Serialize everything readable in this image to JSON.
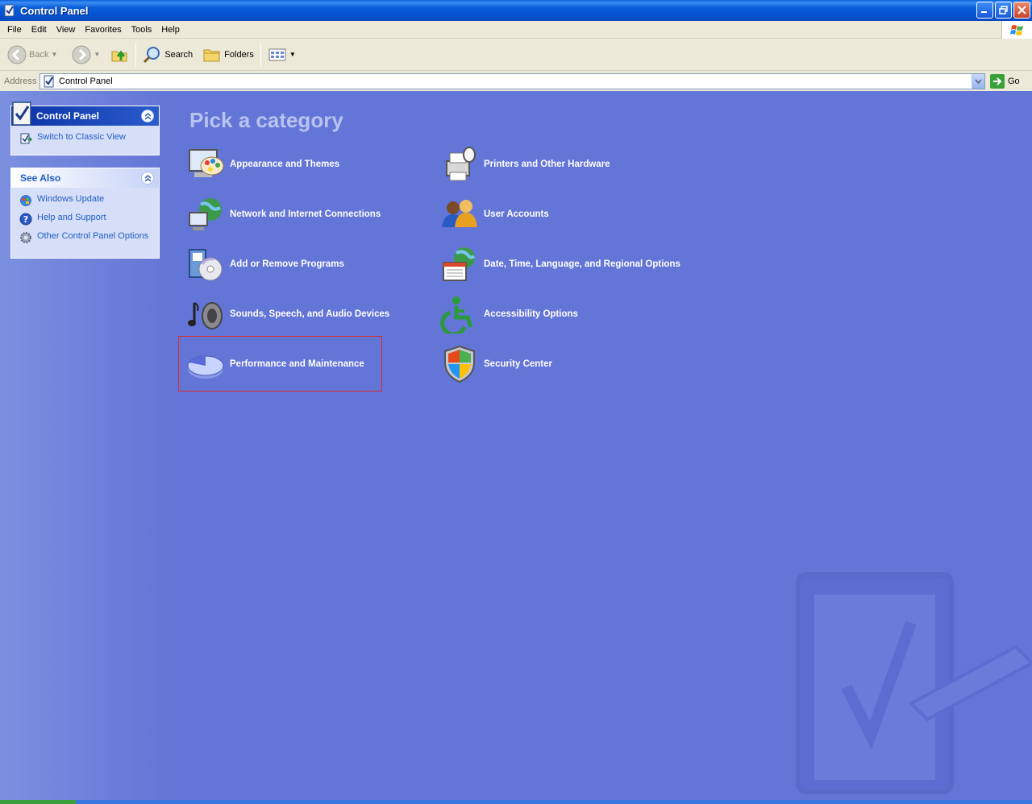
{
  "window": {
    "title": "Control Panel"
  },
  "menu": [
    "File",
    "Edit",
    "View",
    "Favorites",
    "Tools",
    "Help"
  ],
  "toolbar": {
    "back": "Back",
    "search": "Search",
    "folders": "Folders"
  },
  "address": {
    "label": "Address",
    "value": "Control Panel",
    "go": "Go"
  },
  "sidebar": {
    "control_panel": {
      "title": "Control Panel",
      "tasks": [
        {
          "label": "Switch to Classic View",
          "icon": "classic-view-icon"
        }
      ]
    },
    "see_also": {
      "title": "See Also",
      "tasks": [
        {
          "label": "Windows Update",
          "icon": "windows-update-icon"
        },
        {
          "label": "Help and Support",
          "icon": "help-icon"
        },
        {
          "label": "Other Control Panel Options",
          "icon": "gear-icon"
        }
      ]
    }
  },
  "main": {
    "heading": "Pick a category",
    "categories": [
      {
        "label": "Appearance and Themes",
        "icon": "appearance-icon"
      },
      {
        "label": "Printers and Other Hardware",
        "icon": "printer-icon"
      },
      {
        "label": "Network and Internet Connections",
        "icon": "network-icon"
      },
      {
        "label": "User Accounts",
        "icon": "users-icon"
      },
      {
        "label": "Add or Remove Programs",
        "icon": "programs-icon"
      },
      {
        "label": "Date, Time, Language, and Regional Options",
        "icon": "datetime-icon"
      },
      {
        "label": "Sounds, Speech, and Audio Devices",
        "icon": "sounds-icon"
      },
      {
        "label": "Accessibility Options",
        "icon": "accessibility-icon"
      },
      {
        "label": "Performance and Maintenance",
        "icon": "performance-icon"
      },
      {
        "label": "Security Center",
        "icon": "shield-icon"
      }
    ]
  }
}
